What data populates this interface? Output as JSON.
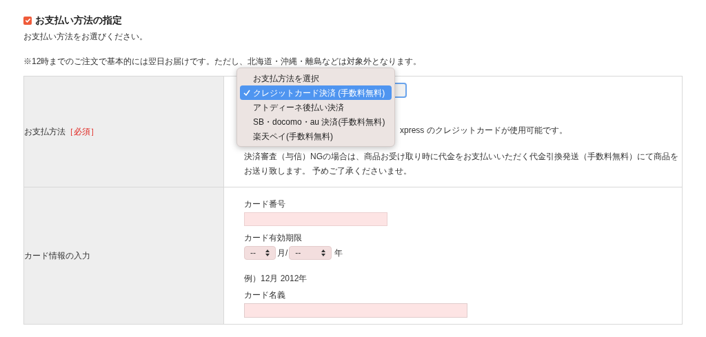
{
  "section": {
    "title": "お支払い方法の指定",
    "checked": true,
    "intro": "お支払い方法をお選びください。",
    "note": "※12時までのご注文で基本的には翌日お届けです。ただし、北海道・沖縄・離島などは対象外となります。"
  },
  "payment_row": {
    "label": "お支払方法",
    "required": "［必須］",
    "partial_text": "xpress のクレジットカードが使用可能です。",
    "paragraph": "決済審査（与信）NGの場合は、商品お受け取り時に代金をお支払いいただく代金引換発送（手数料無料）にて商品をお送り致します。 予めご了承くださいませ。"
  },
  "dropdown": {
    "options": [
      {
        "label": "お支払方法を選択",
        "selected": false
      },
      {
        "label": "クレジットカード決済 (手数料無料)",
        "selected": true
      },
      {
        "label": "アトディーネ後払い決済",
        "selected": false
      },
      {
        "label": "SB・docomo・au 決済(手数料無料)",
        "selected": false
      },
      {
        "label": "楽天ペイ(手数料無料)",
        "selected": false
      }
    ]
  },
  "card_row": {
    "label": "カード情報の入力",
    "number_label": "カード番号",
    "expiry_label": "カード有効期限",
    "month_value": "--",
    "month_unit": "月/",
    "year_value": "--",
    "year_unit": "年",
    "example": "例）12月 2012年",
    "name_label": "カード名義"
  }
}
